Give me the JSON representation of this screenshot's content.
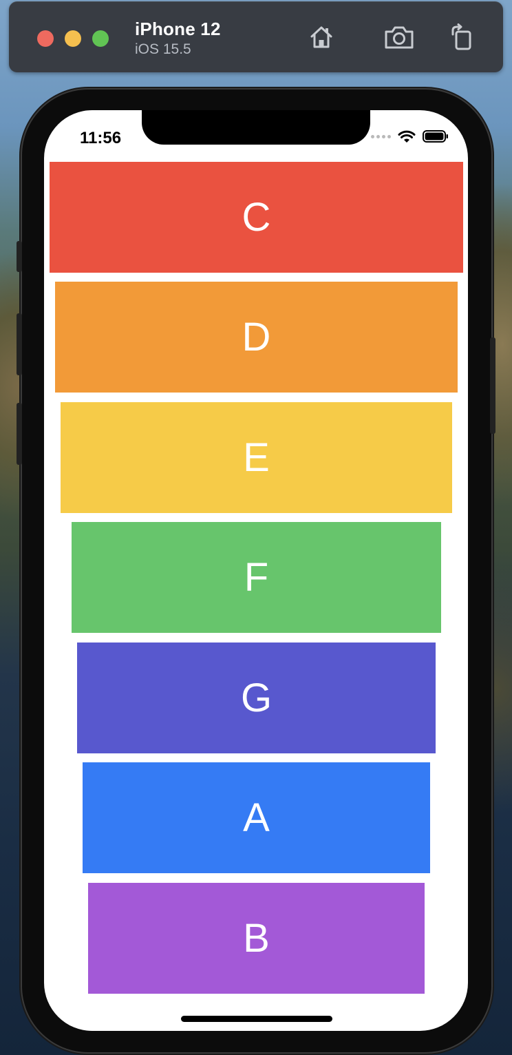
{
  "toolbar": {
    "device_name": "iPhone 12",
    "os_version": "iOS 15.5",
    "icons": [
      "home-icon",
      "screenshot-icon",
      "rotate-icon"
    ]
  },
  "status_bar": {
    "time": "11:56",
    "icons": [
      "signal-dots-icon",
      "wifi-icon",
      "battery-icon"
    ]
  },
  "bars": [
    {
      "label": "C",
      "color": "#EA5240"
    },
    {
      "label": "D",
      "color": "#F29A38"
    },
    {
      "label": "E",
      "color": "#F6CB48"
    },
    {
      "label": "F",
      "color": "#67C56C"
    },
    {
      "label": "G",
      "color": "#5858CE"
    },
    {
      "label": "A",
      "color": "#357BF4"
    },
    {
      "label": "B",
      "color": "#A359D7"
    }
  ]
}
